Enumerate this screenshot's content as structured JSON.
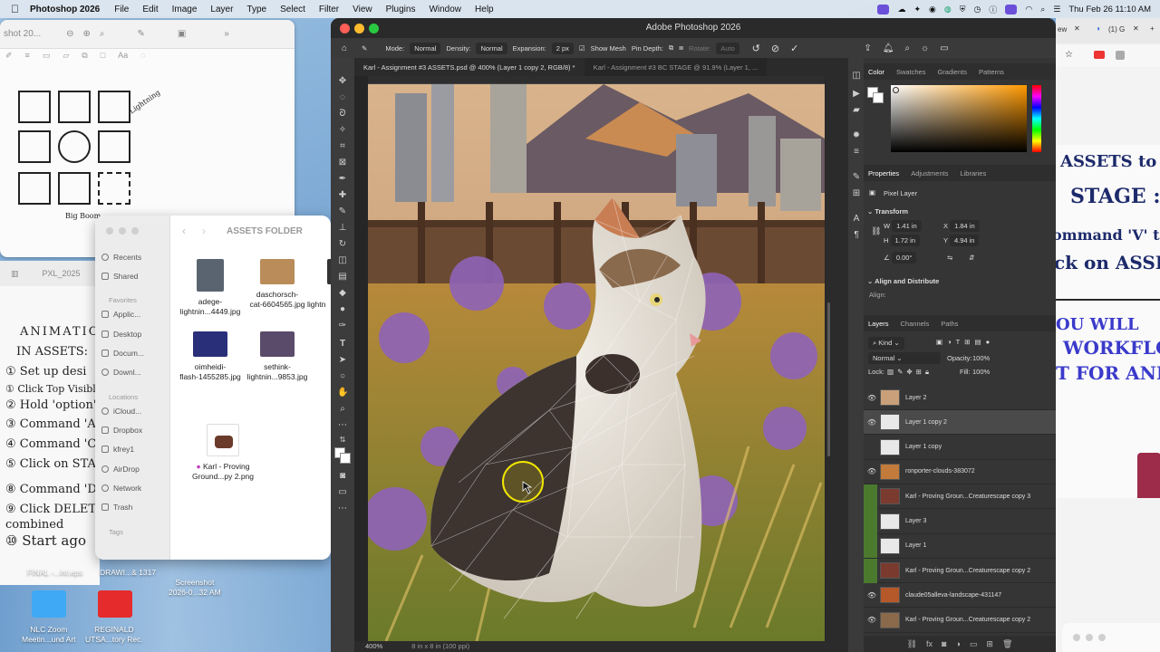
{
  "menubar": {
    "app_name": "Photoshop 2026",
    "items": [
      "File",
      "Edit",
      "Image",
      "Layer",
      "Type",
      "Select",
      "Filter",
      "View",
      "Plugins",
      "Window",
      "Help"
    ],
    "datetime": "Thu Feb 26  11:10 AM"
  },
  "notes": {
    "filename": "shot 20...",
    "filename2": "PXL_2025",
    "sketch_labels": [
      "Lightning",
      "Big Boom"
    ],
    "handwriting_title": "ANIMATION",
    "handwriting_sub": "IN ASSETS:",
    "handwriting_lines": [
      "① Set up desi",
      "① Click Top Visible",
      "② Hold 'option'",
      "③ Command 'A'",
      "④ Command 'C'",
      "⑤ Click on STAG",
      "⑧ Command 'D'",
      "⑨ Click DELETE",
      "   combined",
      "⑩ Start ago"
    ]
  },
  "finder": {
    "title": "ASSETS FOLDER",
    "sidebar": {
      "top": [
        "Recents",
        "Shared"
      ],
      "favorites_header": "Favorites",
      "favorites": [
        "Applic...",
        "Desktop",
        "Docum...",
        "Downl..."
      ],
      "locations_header": "Locations",
      "locations": [
        "iCloud...",
        "Dropbox",
        "kfrey1",
        "AirDrop",
        "Network",
        "Trash"
      ],
      "tags_header": "Tags"
    },
    "files": [
      {
        "name": "adege-\nlightnin...4449.jpg",
        "color": "#5a6470"
      },
      {
        "name": "daschorsch-\ncat-6604565.jpg",
        "color": "#b98c5a"
      },
      {
        "name": "lightn",
        "color": "#333"
      },
      {
        "name": "oimheidi-\nflash-1455285.jpg",
        "color": "#2a2f7a"
      },
      {
        "name": "sethink-\nlightnin...9853.jpg",
        "color": "#5b4b6a"
      },
      {
        "name": "Karl - Proving\nGround...py 2.png",
        "color": "#6b3a2a"
      }
    ]
  },
  "desktop": {
    "items": [
      {
        "label": "FINAL -...int.eps"
      },
      {
        "label": "DRAWI...& 1317"
      },
      {
        "label": "Screenshot\n2026-0...32 AM"
      },
      {
        "label": "NLC Zoom\nMeetin...und Art"
      },
      {
        "label": "REGINALD\nUTSA...tory Rec."
      }
    ]
  },
  "photoshop": {
    "title": "Adobe Photoshop 2026",
    "options": {
      "mode_label": "Mode:",
      "mode_value": "Normal",
      "density_label": "Density:",
      "density_value": "Normal",
      "expansion_label": "Expansion:",
      "expansion_value": "2 px",
      "show_mesh": "Show Mesh",
      "pin_depth": "Pin Depth:",
      "rotate_label": "Rotate:",
      "rotate_value": "Auto"
    },
    "tabs": [
      "Karl - Assignment #3 ASSETS.psd @ 400% (Layer 1 copy 2, RGB/8) *",
      "Karl - Assignment #3 BC STAGE @ 91.9% (Layer 1, ..."
    ],
    "status": {
      "zoom": "400%",
      "doc": "8 in x 8 in (100 ppi)"
    },
    "color_tabs": [
      "Color",
      "Swatches",
      "Gradients",
      "Patterns"
    ],
    "properties_tabs": [
      "Properties",
      "Adjustments",
      "Libraries"
    ],
    "pixel_layer": "Pixel Layer",
    "transform_header": "Transform",
    "transform": {
      "w": "1.41 in",
      "x": "1.84 in",
      "h": "1.72 in",
      "y": "4.94 in",
      "angle": "0.00°"
    },
    "align_header": "Align and Distribute",
    "align_label": "Align:",
    "layers_tabs": [
      "Layers",
      "Channels",
      "Paths"
    ],
    "kind": "Kind",
    "blend": "Normal",
    "opacity_label": "Opacity:",
    "opacity": "100%",
    "lock_label": "Lock:",
    "fill_label": "Fill:",
    "fill": "100%",
    "layers": [
      {
        "name": "Layer 2",
        "visible": true,
        "group": false,
        "thumb": "#c9a07a"
      },
      {
        "name": "Layer 1 copy 2",
        "visible": true,
        "group": false,
        "thumb": "#e8e8e8",
        "selected": true
      },
      {
        "name": "Layer 1 copy",
        "visible": false,
        "group": false,
        "thumb": "#e8e8e8"
      },
      {
        "name": "ronporter-clouds-383072",
        "visible": true,
        "group": false,
        "thumb": "#c27b3a"
      },
      {
        "name": "Karl - Proving Groun...Creaturescape copy 3",
        "visible": false,
        "group": true,
        "thumb": "#7a3b2e"
      },
      {
        "name": "Layer 3",
        "visible": false,
        "group": true,
        "thumb": "#e8e8e8"
      },
      {
        "name": "Layer 1",
        "visible": false,
        "group": true,
        "thumb": "#e8e8e8"
      },
      {
        "name": "Karl - Proving Groun...Creaturescape copy 2",
        "visible": false,
        "group": true,
        "thumb": "#7a3b2e"
      },
      {
        "name": "claude05alleva-landscape-431147",
        "visible": true,
        "group": false,
        "thumb": "#b5582a"
      },
      {
        "name": "Karl - Proving Groun...Creaturescape copy 2",
        "visible": true,
        "group": false,
        "thumb": "#8a6a4a"
      }
    ]
  },
  "whiteboard": {
    "lines": [
      "ASSETS to",
      "STAGE :",
      "ommand 'V' to",
      "ck on ASSE",
      "OU WILL",
      "WORKFLO",
      "T FOR ANI"
    ]
  },
  "colors": {
    "ps_bg": "#323232",
    "accent_yellow": "#f2e600",
    "layer_group_green": "#4b7a2f"
  }
}
